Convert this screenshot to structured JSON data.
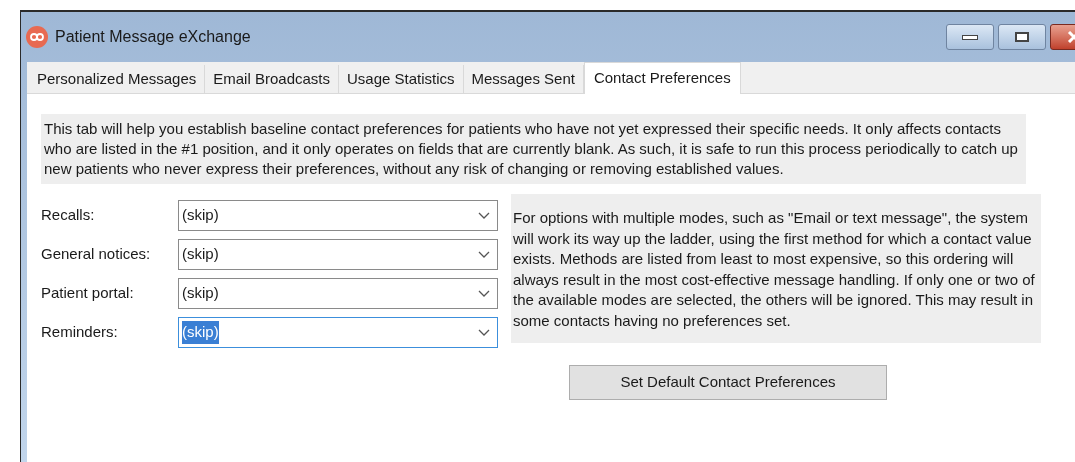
{
  "window": {
    "title": "Patient Message eXchange"
  },
  "tabs": [
    {
      "label": "Personalized Messages",
      "selected": false
    },
    {
      "label": "Email Broadcasts",
      "selected": false
    },
    {
      "label": "Usage Statistics",
      "selected": false
    },
    {
      "label": "Messages Sent",
      "selected": false
    },
    {
      "label": "Contact Preferences",
      "selected": true
    }
  ],
  "intro": "This tab will help you establish baseline contact preferences for patients who have not yet expressed their specific needs. It only affects contacts who are listed in the #1 position, and it only operates on fields that are currently blank. As such, it is safe to run this process periodically to catch up new patients who never express their preferences, without any risk of changing or removing established values.",
  "fields": [
    {
      "label": "Recalls:",
      "value": "(skip)",
      "focused": false
    },
    {
      "label": "General notices:",
      "value": "(skip)",
      "focused": false
    },
    {
      "label": "Patient portal:",
      "value": "(skip)",
      "focused": false
    },
    {
      "label": "Reminders:",
      "value": "(skip)",
      "focused": true
    }
  ],
  "note": "For options with multiple modes, such as \"Email or text message\", the system will work its way up the ladder, using the first method for which a contact value exists. Methods are listed from least to most expensive, so this ordering will always result in the most cost-effective message handling. If only one or two of the available modes are selected, the others will be ignored. This may result in some contacts having no preferences set.",
  "button": "Set Default Contact Preferences"
}
